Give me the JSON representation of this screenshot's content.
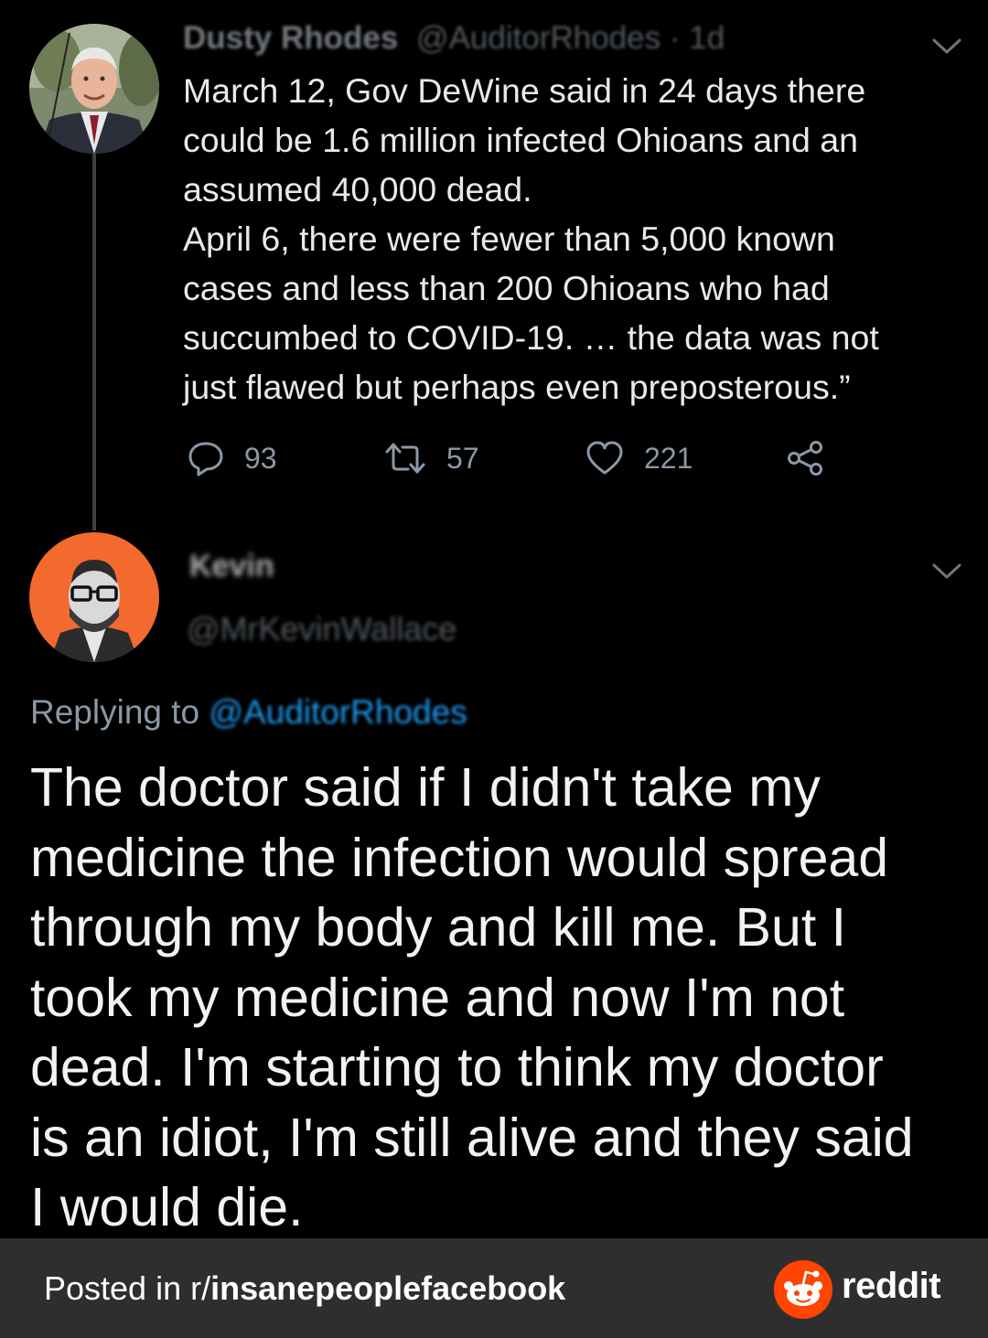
{
  "tweet": {
    "author_name": "Dusty Rhodes",
    "author_handle": "@AuditorRhodes",
    "time": "· 1d",
    "lines": [
      "March 12, Gov DeWine said in 24 days there",
      "could be 1.6 million infected Ohioans and an",
      "assumed 40,000 dead.",
      "April 6, there were fewer than 5,000 known",
      "cases and less than 200 Ohioans who had",
      "succumbed to COVID-19. … the data was not",
      "just flawed but perhaps even preposterous.”"
    ],
    "actions": {
      "replies": "93",
      "retweets": "57",
      "likes": "221"
    }
  },
  "reply": {
    "author_name": "Kevin",
    "author_handle": "@MrKevinWallace",
    "replying_prefix": "Replying to",
    "replying_mention": "@AuditorRhodes",
    "lines": [
      "The doctor said if I didn't take my",
      "medicine the infection would spread",
      "through my body and kill me. But I",
      "took my medicine and now I'm not",
      "dead. I'm starting to think my doctor",
      "is an idiot, I'm still alive and they said",
      "I would die."
    ]
  },
  "footer": {
    "posted_in": "Posted in r/",
    "subreddit": "insanepeoplefacebook",
    "brand": "reddit"
  },
  "colors": {
    "background": "#000000",
    "text": "#e7e9ea",
    "muted": "#8b98a5",
    "link": "#1d9bf0",
    "avatar2_bg": "#f26a2e",
    "footer_bg": "#2e2e2f",
    "reddit_orange": "#ff4500"
  },
  "icons": [
    "reply-icon",
    "retweet-icon",
    "like-icon",
    "share-icon",
    "chevron-down-icon",
    "reddit-logo-icon"
  ]
}
